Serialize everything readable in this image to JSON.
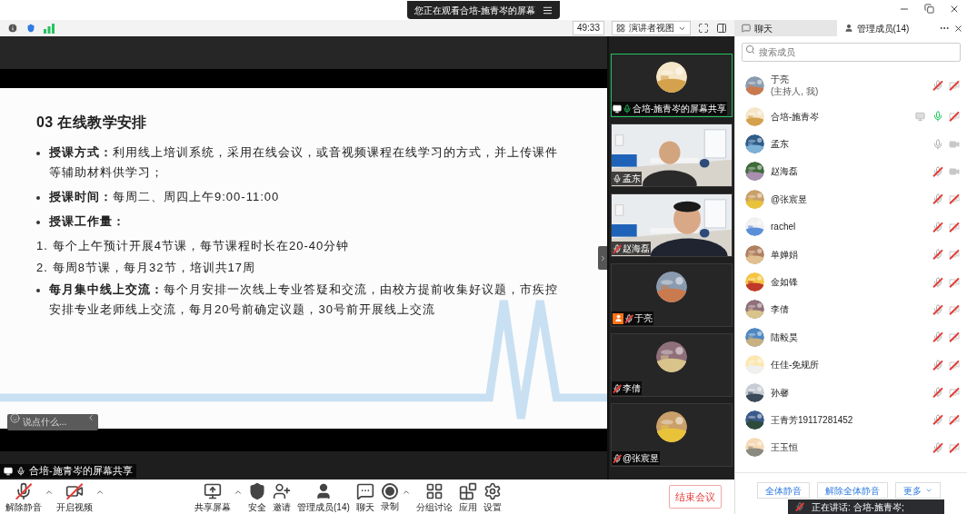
{
  "title_bar": {
    "viewing_notice": "您正在观看合培-施青岑的屏幕"
  },
  "toolbar": {
    "timer": "49:33",
    "view_menu": "演讲者视图"
  },
  "side_tabs": [
    {
      "label": "聊天",
      "selected": false
    },
    {
      "label": "管理成员(14)",
      "selected": true
    }
  ],
  "slide": {
    "title": "03 在线教学安排",
    "items": [
      {
        "kind": "bullet",
        "text": "**授课方式：**利用线上培训系统，采用在线会议，或音视频课程在线学习的方式，并上传课件等辅助材料供学习；"
      },
      {
        "kind": "bullet",
        "text": "**授课时间：**每周二、周四上午9:00-11:00"
      },
      {
        "kind": "bullet",
        "text": "**授课工作量：**"
      },
      {
        "kind": "numbered",
        "number": "1.",
        "text": "每个上午预计开展4节课，每节课程时长在20-40分钟"
      },
      {
        "kind": "numbered",
        "number": "2.",
        "text": "每周8节课，每月32节，培训共17周"
      },
      {
        "kind": "bullet",
        "text": "**每月集中线上交流：**每个月安排一次线上专业答疑和交流，由校方提前收集好议题，市疾控安排专业老师线上交流，每月20号前确定议题，30号前开展线上交流"
      }
    ]
  },
  "comment_box": {
    "placeholder": "说点什么..."
  },
  "share_label": "合培-施青岑的屏幕共享",
  "video_tiles": [
    {
      "name": "合培-施青岑的屏幕共享",
      "kind": "avatar",
      "muted": false,
      "speaking": true,
      "active": true,
      "host": false,
      "sharing": true
    },
    {
      "name": "孟东",
      "kind": "video",
      "muted": false,
      "speaking": false,
      "active": false,
      "host": false,
      "sharing": false
    },
    {
      "name": "赵海磊",
      "kind": "video",
      "muted": true,
      "speaking": false,
      "active": false,
      "host": false,
      "sharing": false
    },
    {
      "name": "于亮",
      "kind": "avatar",
      "muted": true,
      "speaking": false,
      "active": false,
      "host": true,
      "sharing": false
    },
    {
      "name": "李倩",
      "kind": "avatar",
      "muted": true,
      "speaking": false,
      "active": false,
      "host": false,
      "sharing": false
    },
    {
      "name": "@张宸昱",
      "kind": "avatar",
      "muted": true,
      "speaking": false,
      "active": false,
      "host": false,
      "sharing": false
    }
  ],
  "participants": {
    "search_placeholder": "搜索成员",
    "members": [
      {
        "name": "于亮",
        "role": "(主持人, 我)",
        "muted": true,
        "speaking": false,
        "video_on": false,
        "sharing": false
      },
      {
        "name": "合培-施青岑",
        "muted": false,
        "speaking": true,
        "video_on": false,
        "sharing": true
      },
      {
        "name": "孟东",
        "muted": false,
        "speaking": false,
        "video_on": true,
        "sharing": false
      },
      {
        "name": "赵海磊",
        "muted": true,
        "speaking": false,
        "video_on": true,
        "sharing": false
      },
      {
        "name": "@张宸昱",
        "muted": true,
        "speaking": false,
        "video_on": false,
        "sharing": false
      },
      {
        "name": "rachel",
        "muted": true,
        "speaking": false,
        "video_on": false,
        "sharing": false
      },
      {
        "name": "单婵娟",
        "muted": true,
        "speaking": false,
        "video_on": false,
        "sharing": false
      },
      {
        "name": "金如锋",
        "muted": true,
        "speaking": false,
        "video_on": false,
        "sharing": false
      },
      {
        "name": "李倩",
        "muted": true,
        "speaking": false,
        "video_on": false,
        "sharing": false
      },
      {
        "name": "陆毅昊",
        "muted": true,
        "speaking": false,
        "video_on": false,
        "sharing": false
      },
      {
        "name": "任佳-免规所",
        "muted": true,
        "speaking": false,
        "video_on": false,
        "sharing": false
      },
      {
        "name": "孙馨",
        "muted": true,
        "speaking": false,
        "video_on": false,
        "sharing": false
      },
      {
        "name": "王青芳19117281452",
        "muted": true,
        "speaking": false,
        "video_on": false,
        "sharing": false
      },
      {
        "name": "王玉恒",
        "muted": true,
        "speaking": false,
        "video_on": false,
        "sharing": false
      }
    ]
  },
  "panel_buttons": [
    "全体静音",
    "解除全体静音",
    "更多"
  ],
  "speaking_toast": "正在讲话: 合培-施青岑;",
  "controls": [
    {
      "label": "解除静音",
      "kind": "mic_off",
      "menu": true
    },
    {
      "label": "开启视频",
      "kind": "video_off",
      "menu": true
    },
    {
      "label": "共享屏幕",
      "kind": "share",
      "menu": true
    },
    {
      "label": "安全",
      "kind": "security",
      "menu": false
    },
    {
      "label": "邀请",
      "kind": "invite",
      "menu": false
    },
    {
      "label": "管理成员(14)",
      "kind": "members",
      "menu": false
    },
    {
      "label": "聊天",
      "kind": "chat",
      "menu": false
    },
    {
      "label": "录制",
      "kind": "record",
      "menu": true
    },
    {
      "label": "分组讨论",
      "kind": "breakout",
      "menu": false
    },
    {
      "label": "应用",
      "kind": "apps",
      "menu": false
    },
    {
      "label": "设置",
      "kind": "settings",
      "menu": false
    }
  ],
  "end_button": "结束会议"
}
